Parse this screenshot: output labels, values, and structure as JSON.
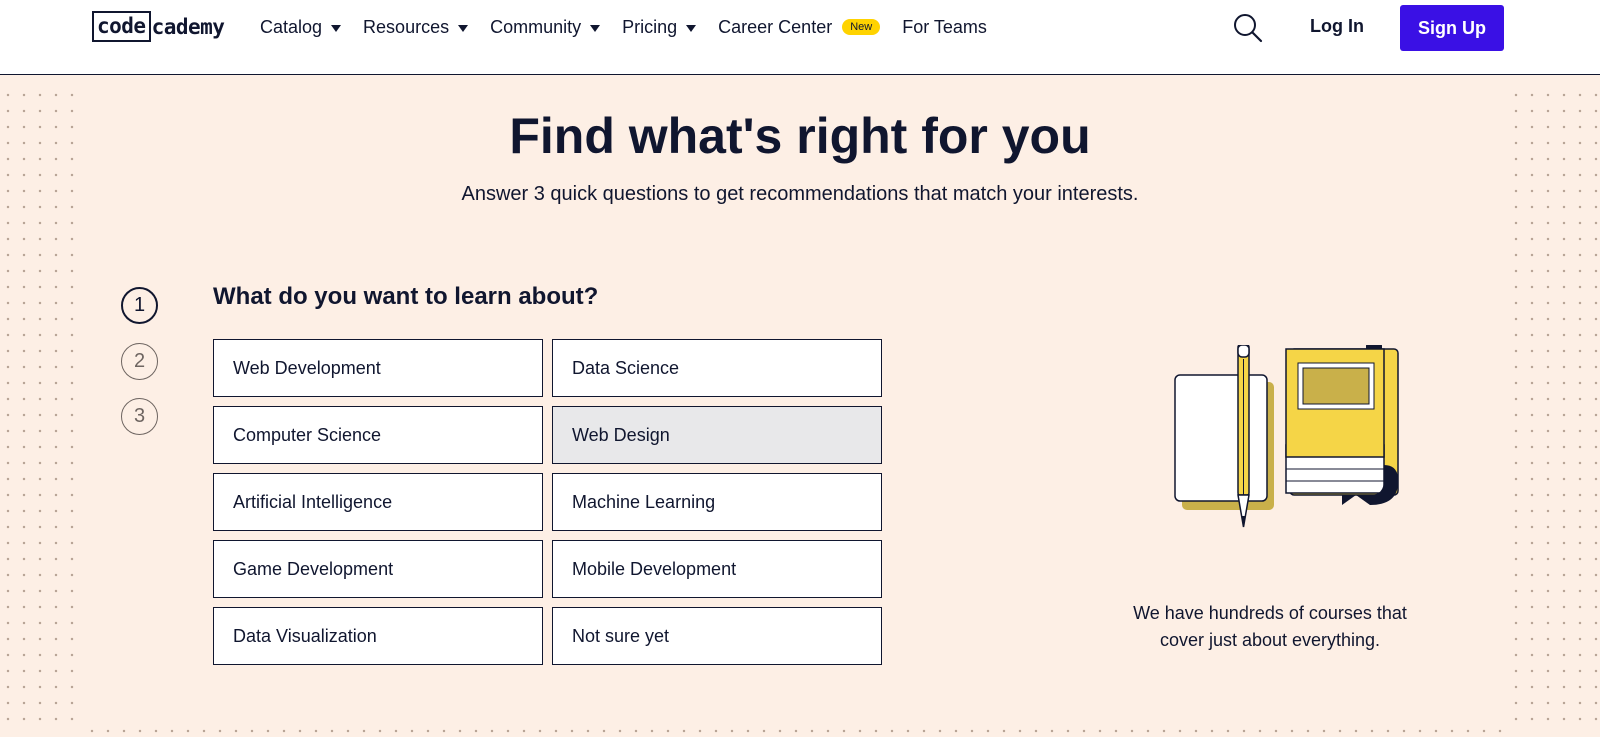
{
  "header": {
    "logo": {
      "box_text": "code",
      "rest_text": "cademy"
    },
    "nav": [
      {
        "label": "Catalog",
        "has_caret": true
      },
      {
        "label": "Resources",
        "has_caret": true
      },
      {
        "label": "Community",
        "has_caret": true
      },
      {
        "label": "Pricing",
        "has_caret": true
      },
      {
        "label": "Career Center",
        "has_caret": false,
        "badge": "New"
      },
      {
        "label": "For Teams",
        "has_caret": false
      }
    ],
    "search_icon": "search-icon",
    "login_label": "Log In",
    "signup_label": "Sign Up"
  },
  "hero": {
    "title": "Find what's right for you",
    "subtitle": "Answer 3 quick questions to get recommendations that match your interests."
  },
  "steps": [
    {
      "number": "1",
      "state": "active"
    },
    {
      "number": "2",
      "state": "inactive"
    },
    {
      "number": "3",
      "state": "inactive"
    }
  ],
  "question": "What do you want to learn about?",
  "options": [
    {
      "label": "Web Development",
      "hover": false
    },
    {
      "label": "Data Science",
      "hover": false
    },
    {
      "label": "Computer Science",
      "hover": false
    },
    {
      "label": "Web Design",
      "hover": true
    },
    {
      "label": "Artificial Intelligence",
      "hover": false
    },
    {
      "label": "Machine Learning",
      "hover": false
    },
    {
      "label": "Game Development",
      "hover": false
    },
    {
      "label": "Mobile Development",
      "hover": false
    },
    {
      "label": "Data Visualization",
      "hover": false
    },
    {
      "label": "Not sure yet",
      "hover": false
    }
  ],
  "illustration": {
    "icon": "books-and-pencil-illustration"
  },
  "tagline": {
    "line1": "We have hundreds of courses that",
    "line2": "cover just about everything."
  },
  "colors": {
    "brand": "#3a10e5",
    "text": "#10162f",
    "background": "#fdefe5",
    "badge": "#ffd300",
    "book_yellow": "#f5d547",
    "book_shadow": "#c9b04a",
    "option_hover": "#e8e8ea"
  }
}
